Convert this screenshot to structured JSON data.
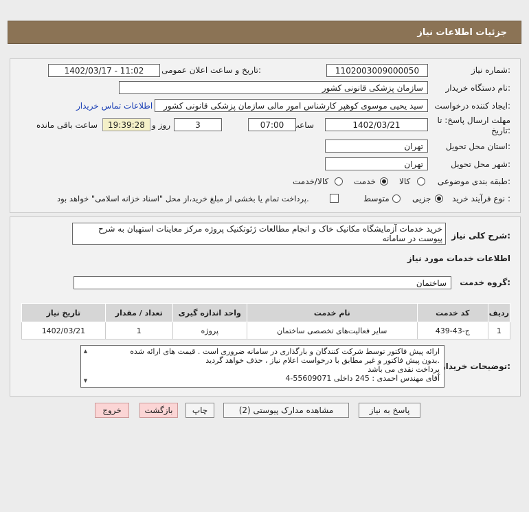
{
  "header": {
    "title": "جزئیات اطلاعات نیاز"
  },
  "form": {
    "need_number_label": "شماره نیاز:",
    "need_number": "1102003009000050",
    "announce_label": "تاریخ و ساعت اعلان عمومی:",
    "announce_value": "1402/03/17 - 11:02",
    "buyer_org_label": "نام دستگاه خریدار:",
    "buyer_org": "سازمان پزشکی قانونی کشور",
    "creator_label": "ایجاد کننده درخواست:",
    "creator": "سید یحیی موسوی کوهپر کارشناس امور مالی سازمان پزشکی قانونی کشور",
    "contact_link": "اطلاعات تماس خریدار",
    "deadline_label": "مهلت ارسال پاسخ: تا",
    "deadline_label2": "تاریخ:",
    "deadline_date": "1402/03/21",
    "time_label": "ساعت",
    "deadline_time": "07:00",
    "days_value": "3",
    "days_label": "روز و",
    "remaining_time": "19:39:28",
    "remaining_label": "ساعت باقی مانده",
    "province_label": "استان محل تحویل:",
    "province": "تهران",
    "city_label": "شهر محل تحویل:",
    "city": "تهران",
    "category_label": "طبقه بندی موضوعی:",
    "category_options": [
      "کالا",
      "خدمت",
      "کالا/خدمت"
    ],
    "category_selected": 1,
    "process_label": "نوع فرآیند خرید :",
    "process_options": [
      "جزیی",
      "متوسط"
    ],
    "process_selected": 0,
    "payment_text": "پرداخت تمام یا بخشی از مبلغ خرید،از محل \"اسناد خزانه اسلامی\" خواهد بود."
  },
  "description": {
    "label": "شرح کلی نیاز:",
    "text": "خرید خدمات آزمایشگاه مکانیک خاک و انجام مطالعات ژئوتکنیک پروژه مرکز معاینات استهبان به شرح پیوست در سامانه"
  },
  "services": {
    "section_title": "اطلاعات خدمات مورد نیاز",
    "group_label": "گروه خدمت:",
    "group_value": "ساختمان",
    "columns": [
      "ردیف",
      "کد خدمت",
      "نام خدمت",
      "واحد اندازه گیری",
      "تعداد / مقدار",
      "تاریخ نیاز"
    ],
    "rows": [
      {
        "index": "1",
        "code": "ج-43-439",
        "name": "سایر فعالیت‌های تخصصی ساختمان",
        "unit": "پروژه",
        "qty": "1",
        "date": "1402/03/21"
      }
    ]
  },
  "notes": {
    "label": "توضیحات خریدار:",
    "lines": [
      "ارائه پیش فاکتور  توسط شرکت کنندگان و بارگذاری در سامانه ضروری است . قیمت های ارائه شده",
      "بدون پیش فاکتور  و غیر مطابق با درخواست اعلام نیاز  ، حذف خواهد گردید.",
      "پرداخت نقدی می باشد",
      "آقای مهندس احمدی :   245   داخلی        55609071-4"
    ]
  },
  "buttons": {
    "reply": "پاسخ به نیاز",
    "attachments": "مشاهده مدارک پیوستی (2)",
    "print": "چاپ",
    "back": "بازگشت",
    "exit": "خروج"
  }
}
